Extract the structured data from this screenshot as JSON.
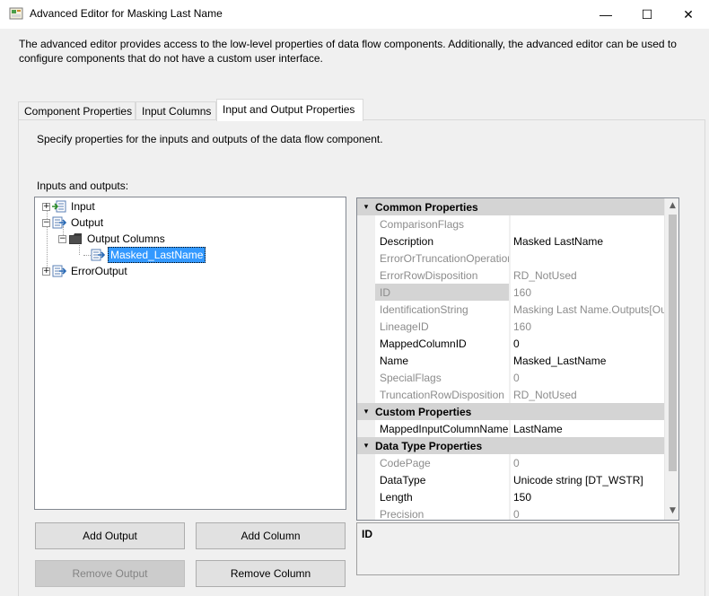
{
  "window": {
    "title": "Advanced Editor for Masking Last Name",
    "min_glyph": "—",
    "max_glyph": "☐",
    "close_glyph": "✕"
  },
  "description": "The advanced editor provides access to the low-level properties of data flow components. Additionally, the advanced editor can be used to configure components that do not have a custom user interface.",
  "tabs": [
    {
      "label": "Component Properties",
      "active": false
    },
    {
      "label": "Input Columns",
      "active": false
    },
    {
      "label": "Input and Output Properties",
      "active": true
    }
  ],
  "panel": {
    "description": "Specify properties for the inputs and outputs of the data flow component.",
    "io_label": "Inputs and outputs:"
  },
  "tree": {
    "expand_glyph": "+",
    "collapse_glyph": "−",
    "nodes": [
      {
        "label": "Input",
        "icon": "input-icon",
        "expanded": false
      },
      {
        "label": "Output",
        "icon": "output-icon",
        "expanded": true
      },
      {
        "label": "Output Columns",
        "icon": "folder-icon",
        "expanded": true
      },
      {
        "label": "Masked_LastName",
        "icon": "column-icon",
        "selected": true
      },
      {
        "label": "ErrorOutput",
        "icon": "output-icon",
        "expanded": false
      }
    ]
  },
  "properties": {
    "collapse_glyph": "▾",
    "categories": [
      {
        "name": "Common Properties",
        "rows": [
          {
            "name": "ComparisonFlags",
            "value": "",
            "readonly": true
          },
          {
            "name": "Description",
            "value": "Masked LastName",
            "readonly": false
          },
          {
            "name": "ErrorOrTruncationOperation",
            "value": "",
            "readonly": true
          },
          {
            "name": "ErrorRowDisposition",
            "value": "RD_NotUsed",
            "readonly": true
          },
          {
            "name": "ID",
            "value": "160",
            "readonly": true,
            "selected": true
          },
          {
            "name": "IdentificationString",
            "value": "Masking Last Name.Outputs[Ou",
            "readonly": true
          },
          {
            "name": "LineageID",
            "value": "160",
            "readonly": true
          },
          {
            "name": "MappedColumnID",
            "value": "0",
            "readonly": false
          },
          {
            "name": "Name",
            "value": "Masked_LastName",
            "readonly": false
          },
          {
            "name": "SpecialFlags",
            "value": "0",
            "readonly": true
          },
          {
            "name": "TruncationRowDisposition",
            "value": "RD_NotUsed",
            "readonly": true
          }
        ]
      },
      {
        "name": "Custom Properties",
        "rows": [
          {
            "name": "MappedInputColumnName",
            "value": "LastName",
            "readonly": false
          }
        ]
      },
      {
        "name": "Data Type Properties",
        "rows": [
          {
            "name": "CodePage",
            "value": "0",
            "readonly": true
          },
          {
            "name": "DataType",
            "value": "Unicode string [DT_WSTR]",
            "readonly": false
          },
          {
            "name": "Length",
            "value": "150",
            "readonly": false
          },
          {
            "name": "Precision",
            "value": "0",
            "readonly": true
          }
        ]
      }
    ],
    "scroll_up_glyph": "▲",
    "scroll_down_glyph": "▼"
  },
  "description_box": {
    "title": "ID"
  },
  "buttons": {
    "add_output": "Add Output",
    "add_column": "Add Column",
    "remove_output": "Remove Output",
    "remove_column": "Remove Column"
  }
}
